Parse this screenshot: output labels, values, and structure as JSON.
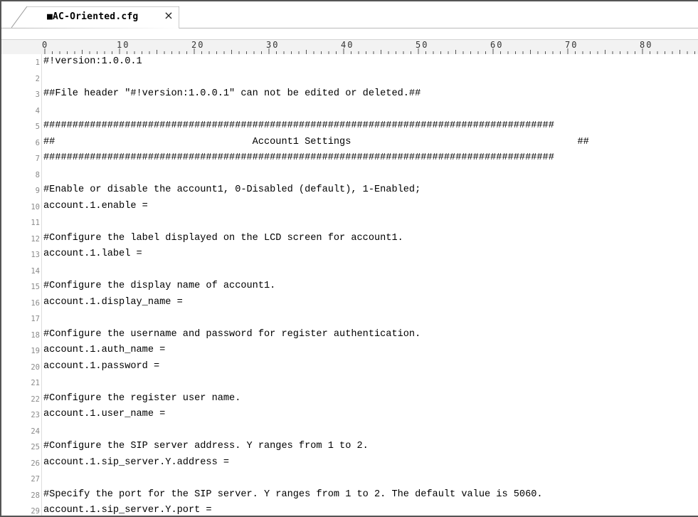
{
  "tab": {
    "title": "■AC-Oriented.cfg",
    "close_glyph": "×"
  },
  "ruler": {
    "labels": [
      "0",
      "10",
      "20",
      "30",
      "40",
      "50",
      "60",
      "70",
      "80"
    ]
  },
  "editor": {
    "lines": [
      {
        "n": "1",
        "text": "#!version:1.0.0.1"
      },
      {
        "n": "2",
        "text": ""
      },
      {
        "n": "3",
        "text": "##File header \"#!version:1.0.0.1\" can not be edited or deleted.##"
      },
      {
        "n": "4",
        "text": ""
      },
      {
        "n": "5",
        "text": "########################################################################################"
      },
      {
        "n": "6",
        "text": "##                                  Account1 Settings                                       ##"
      },
      {
        "n": "7",
        "text": "########################################################################################"
      },
      {
        "n": "8",
        "text": ""
      },
      {
        "n": "9",
        "text": "#Enable or disable the account1, 0-Disabled (default), 1-Enabled;"
      },
      {
        "n": "10",
        "text": "account.1.enable ="
      },
      {
        "n": "11",
        "text": ""
      },
      {
        "n": "12",
        "text": "#Configure the label displayed on the LCD screen for account1."
      },
      {
        "n": "13",
        "text": "account.1.label ="
      },
      {
        "n": "14",
        "text": ""
      },
      {
        "n": "15",
        "text": "#Configure the display name of account1."
      },
      {
        "n": "16",
        "text": "account.1.display_name ="
      },
      {
        "n": "17",
        "text": ""
      },
      {
        "n": "18",
        "text": "#Configure the username and password for register authentication."
      },
      {
        "n": "19",
        "text": "account.1.auth_name ="
      },
      {
        "n": "20",
        "text": "account.1.password ="
      },
      {
        "n": "21",
        "text": ""
      },
      {
        "n": "22",
        "text": "#Configure the register user name."
      },
      {
        "n": "23",
        "text": "account.1.user_name ="
      },
      {
        "n": "24",
        "text": ""
      },
      {
        "n": "25",
        "text": "#Configure the SIP server address. Y ranges from 1 to 2."
      },
      {
        "n": "26",
        "text": "account.1.sip_server.Y.address ="
      },
      {
        "n": "27",
        "text": ""
      },
      {
        "n": "28",
        "text": "#Specify the port for the SIP server. Y ranges from 1 to 2. The default value is 5060."
      },
      {
        "n": "29",
        "text": "account.1.sip_server.Y.port ="
      }
    ]
  }
}
